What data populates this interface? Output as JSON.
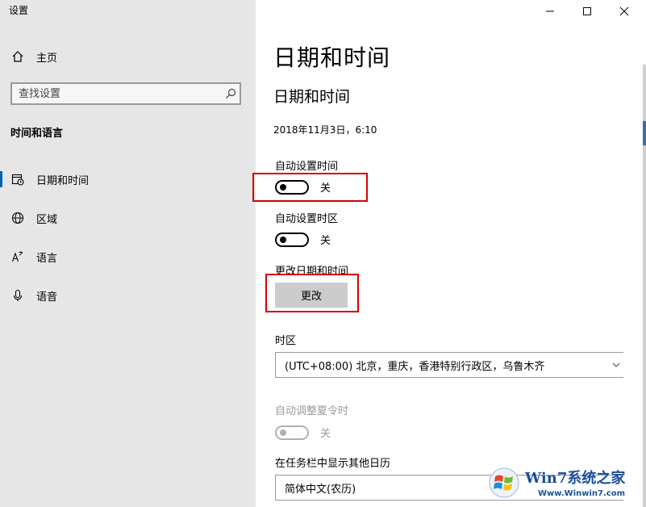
{
  "app": {
    "title": "设置"
  },
  "sidebar": {
    "home_label": "主页",
    "search_placeholder": "查找设置",
    "group_title": "时间和语言",
    "items": [
      {
        "label": "日期和时间",
        "icon": "calendar-clock-icon",
        "active": true
      },
      {
        "label": "区域",
        "icon": "globe-icon"
      },
      {
        "label": "语言",
        "icon": "language-icon"
      },
      {
        "label": "语音",
        "icon": "microphone-icon"
      }
    ]
  },
  "main": {
    "page_title": "日期和时间",
    "section_title": "日期和时间",
    "current_datetime": "2018年11月3日，6:10",
    "auto_time": {
      "label": "自动设置时间",
      "state": "关"
    },
    "auto_timezone": {
      "label": "自动设置时区",
      "state": "关"
    },
    "change_datetime": {
      "label": "更改日期和时间",
      "button": "更改"
    },
    "timezone": {
      "label": "时区",
      "value": "(UTC+08:00) 北京，重庆，香港特别行政区，乌鲁木齐"
    },
    "dst": {
      "label": "自动调整夏令时",
      "state": "关"
    },
    "calendar": {
      "label": "在任务栏中显示其他日历",
      "value": "简体中文(农历)"
    }
  },
  "watermark": {
    "brand": "Win7系统之家",
    "url": "Www.Winwin7.com"
  },
  "colors": {
    "accent": "#0063b1",
    "highlight_box": "#d40000",
    "sidebar_bg": "#e6e6e6"
  }
}
